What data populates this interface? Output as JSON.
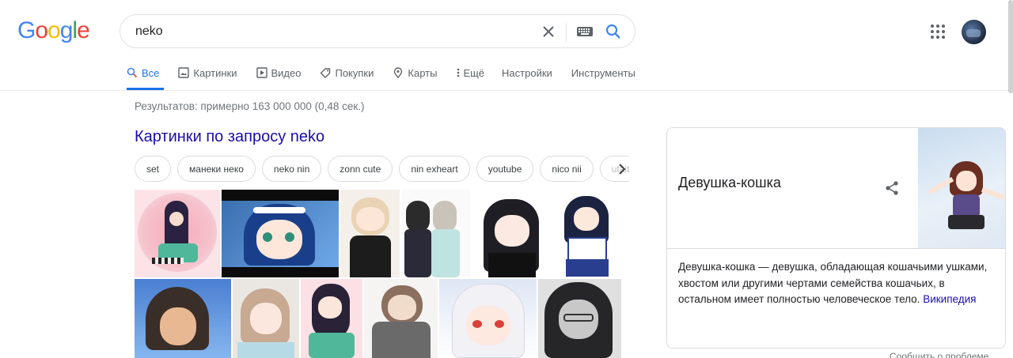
{
  "logo": {
    "letters": [
      "G",
      "o",
      "o",
      "g",
      "l",
      "e"
    ],
    "colors": [
      "#4285f4",
      "#ea4335",
      "#fbbc05",
      "#4285f4",
      "#34a853",
      "#ea4335"
    ]
  },
  "search": {
    "value": "neko",
    "clear_icon": "close-icon",
    "keyboard_icon": "keyboard-icon",
    "search_icon": "search-icon"
  },
  "header": {
    "apps_icon": "apps-grid-icon",
    "avatar": "account-avatar"
  },
  "tabs": [
    {
      "label": "Все",
      "icon": "search-icon",
      "active": true
    },
    {
      "label": "Картинки",
      "icon": "image-icon"
    },
    {
      "label": "Видео",
      "icon": "video-icon"
    },
    {
      "label": "Покупки",
      "icon": "tag-icon"
    },
    {
      "label": "Карты",
      "icon": "map-pin-icon"
    },
    {
      "label": "Ещё",
      "icon": "more-vert-icon"
    },
    {
      "label": "Настройки"
    },
    {
      "label": "Инструменты"
    }
  ],
  "result_stats": "Результатов: примерно 163 000 000 (0,48 сек.)",
  "images_section": {
    "title": "Картинки по запросу neko",
    "chips": [
      "set",
      "манеки неко",
      "neko nin",
      "zonn cute",
      "nin exheart",
      "youtube",
      "nico nii",
      "utaite"
    ],
    "thumbnails": [
      "image-1",
      "image-2",
      "image-3",
      "image-4",
      "image-5",
      "image-6",
      "image-7",
      "image-8",
      "image-9",
      "image-10",
      "image-11",
      "image-12"
    ]
  },
  "knowledge_panel": {
    "title": "Девушка-кошка",
    "description": "Девушка-кошка — девушка, обладающая кошачьими ушками, хвостом или другими чертами семейства кошачьих, в остальном имеет полностью человеческое тело.",
    "source_link": "Википедия"
  },
  "feedback": "Сообщить о проблеме",
  "accent": "#1a73e8",
  "link_color": "#1a0dab"
}
